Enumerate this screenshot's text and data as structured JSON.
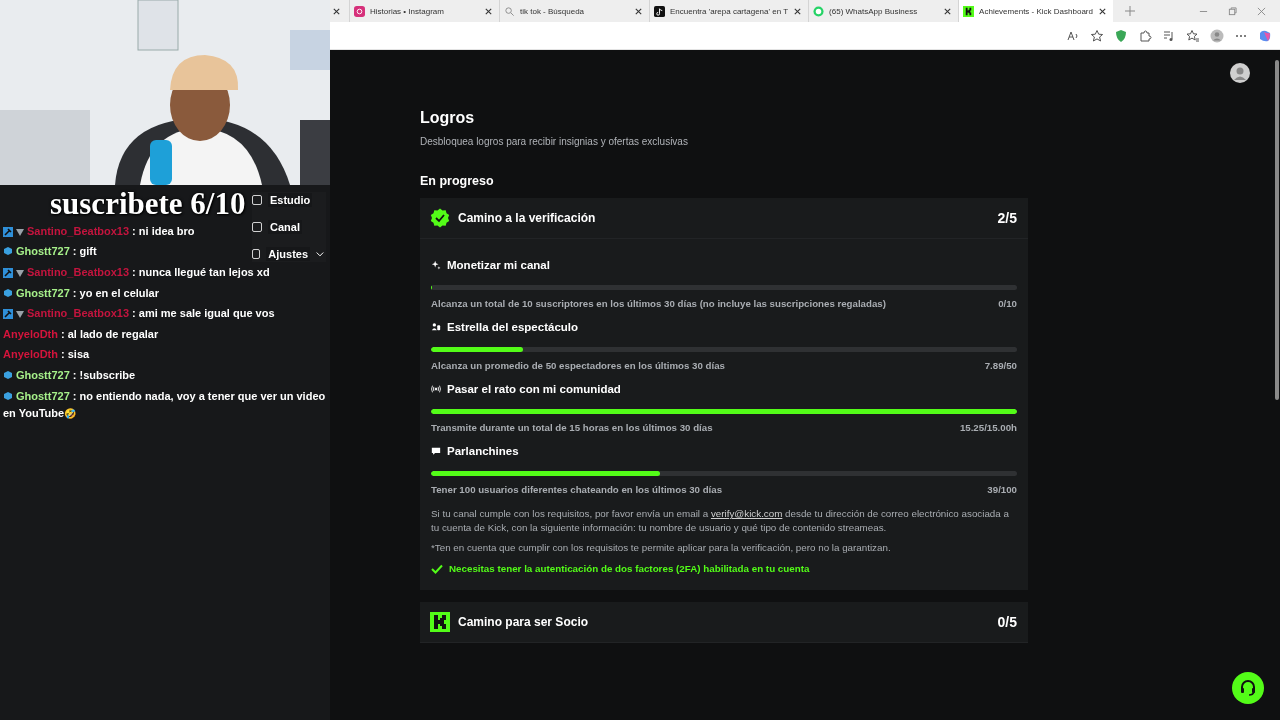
{
  "stream_overlay": {
    "caption": "suscribete 6/10",
    "menu": [
      {
        "label": "Estudio"
      },
      {
        "label": "Canal"
      },
      {
        "label": "Ajustes"
      }
    ]
  },
  "chat": [
    {
      "user": "Santino_Beatbox13",
      "color": "#c4143e",
      "kind": "mod",
      "text": ": ni idea bro"
    },
    {
      "user": "Ghostt727",
      "color": "#a6f08a",
      "kind": "cube",
      "text": ": gift"
    },
    {
      "user": "Santino_Beatbox13",
      "color": "#c4143e",
      "kind": "mod",
      "text": ": nunca llegué tan lejos xd"
    },
    {
      "user": "Ghostt727",
      "color": "#a6f08a",
      "kind": "cube",
      "text": ": yo en el celular"
    },
    {
      "user": "Santino_Beatbox13",
      "color": "#c4143e",
      "kind": "mod",
      "text": ": ami me sale igual que vos"
    },
    {
      "user": "AnyeloDth",
      "color": "#d4143c",
      "kind": "plain",
      "text": ": al lado de regalar"
    },
    {
      "user": "AnyeloDth",
      "color": "#d4143c",
      "kind": "plain",
      "text": ": sisa"
    },
    {
      "user": "Ghostt727",
      "color": "#a6f08a",
      "kind": "cube",
      "text": ": !subscribe"
    },
    {
      "user": "Ghostt727",
      "color": "#a6f08a",
      "kind": "cube",
      "text": ": no entiendo nada, voy a tener que ver un video en YouTube",
      "emoji": "🤣"
    }
  ],
  "browser": {
    "tabs": [
      {
        "title": "Historias • Instagram",
        "kind": "instagram",
        "selected": false
      },
      {
        "title": "tik tok - Búsqueda",
        "kind": "search",
        "selected": false
      },
      {
        "title": "Encuentra 'arepa cartagena' en T",
        "kind": "tiktok",
        "selected": false
      },
      {
        "title": "(65) WhatsApp Business",
        "kind": "whatsapp",
        "selected": false
      },
      {
        "title": "Achievements - Kick Dashboard",
        "kind": "kick",
        "selected": true
      }
    ]
  },
  "page": {
    "title": "Logros",
    "subtitle": "Desbloquea logros para recibir insignias y ofertas exclusivas",
    "section": "En progreso",
    "cards": [
      {
        "title": "Camino a la verificación",
        "kind": "verified",
        "progress": "2/5",
        "goals": [
          {
            "kind": "sparkle",
            "title": "Monetizar mi canal",
            "level": 0,
            "description": "Alcanza un total de 10 suscriptores en los últimos 30 días (no incluye las suscripciones regaladas)",
            "reading": "0/10"
          },
          {
            "kind": "people",
            "title": "Estrella del espectáculo",
            "level": 0.157,
            "description": "Alcanza un promedio de 50 espectadores en los últimos 30 días",
            "reading": "7.89/50"
          },
          {
            "kind": "broadcast",
            "title": "Pasar el rato con mi comunidad",
            "level": 1,
            "description": "Transmite durante un total de 15 horas en los últimos 30 días",
            "reading": "15.25/15.00h"
          },
          {
            "kind": "chat",
            "title": "Parlanchines",
            "level": 0.39,
            "description": "Tener 100 usuarios diferentes chateando en los últimos 30 días",
            "reading": "39/100"
          }
        ],
        "note": {
          "before": "Si tu canal cumple con los requisitos, por favor envía un email a ",
          "link": "verify@kick.com",
          "after": " desde tu dirección de correo electrónico asociada a tu cuenta de Kick, con la siguiente información: tu nombre de usuario y qué tipo de contenido streameas."
        },
        "disclaimer": "*Ten en cuenta que cumplir con los requisitos te permite aplicar para la verificación, pero no la garantizan.",
        "requirement": {
          "text": "Necesitas tener la autenticación de dos factores (2FA) habilitada en tu cuenta",
          "met": true
        }
      },
      {
        "title": "Camino para ser Socio",
        "kind": "kick",
        "progress": "0/5"
      }
    ]
  }
}
